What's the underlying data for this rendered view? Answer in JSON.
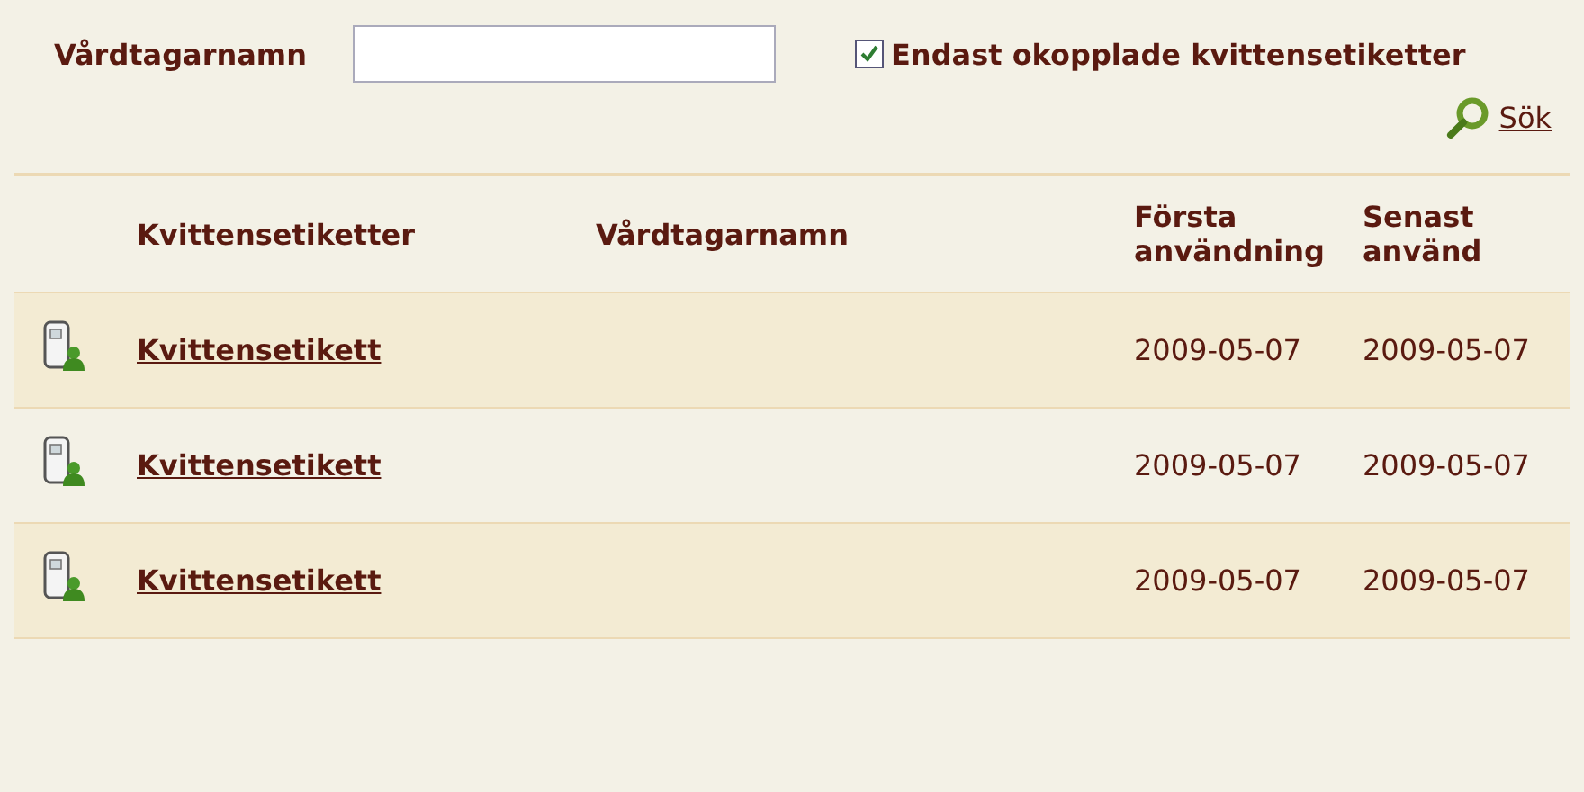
{
  "filter": {
    "label": "Vårdtagarnamn",
    "checkbox": {
      "label": "Endast okopplade kvittensetiketter",
      "checked": true
    },
    "search_link": "Sök"
  },
  "table": {
    "columns": [
      {
        "label": "Kvittensetiketter"
      },
      {
        "label": "Vårdtagarnamn"
      },
      {
        "label": "Första användning"
      },
      {
        "label": "Senast använd"
      }
    ],
    "rows": [
      {
        "name": "Kvittensetikett",
        "first_used": "2009-05-07",
        "last_used": "2009-05-07"
      },
      {
        "name": "Kvittensetikett",
        "first_used": "2009-05-07",
        "last_used": "2009-05-07"
      },
      {
        "name": "Kvittensetikett",
        "first_used": "2009-05-07",
        "last_used": "2009-05-07"
      }
    ]
  }
}
